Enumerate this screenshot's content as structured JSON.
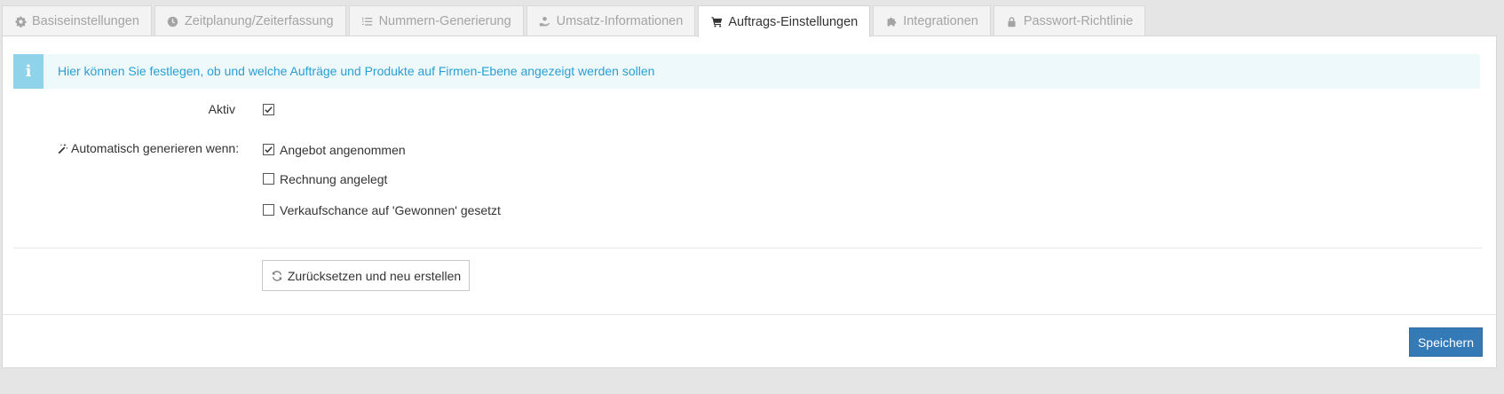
{
  "tabs": [
    {
      "label": "Basiseinstellungen",
      "icon": "gear-icon",
      "active": false
    },
    {
      "label": "Zeitplanung/Zeiterfassung",
      "icon": "clock-icon",
      "active": false
    },
    {
      "label": "Nummern-Generierung",
      "icon": "ordered-list-icon",
      "active": false
    },
    {
      "label": "Umsatz-Informationen",
      "icon": "money-hand-icon",
      "active": false
    },
    {
      "label": "Auftrags-Einstellungen",
      "icon": "shopping-cart-icon",
      "active": true
    },
    {
      "label": "Integrationen",
      "icon": "puzzle-icon",
      "active": false
    },
    {
      "label": "Passwort-Richtlinie",
      "icon": "lock-icon",
      "active": false
    }
  ],
  "info": {
    "icon": "info-icon",
    "text": "Hier können Sie festlegen, ob und welche Aufträge und Produkte auf Firmen-Ebene angezeigt werden sollen"
  },
  "form": {
    "aktiv_label": "Aktiv",
    "aktiv_checked": true,
    "auto_label": "Automatisch generieren wenn:",
    "auto_icon": "magic-wand-icon",
    "options": [
      {
        "label": "Angebot angenommen",
        "checked": true
      },
      {
        "label": "Rechnung angelegt",
        "checked": false
      },
      {
        "label": "Verkaufschance auf 'Gewonnen' gesetzt",
        "checked": false
      }
    ],
    "reset_label": "Zurücksetzen und neu erstellen",
    "reset_icon": "refresh-icon"
  },
  "footer": {
    "save_label": "Speichern"
  },
  "colors": {
    "primary": "#337ab7",
    "info_bg": "#eef9fc",
    "info_accent": "#8fd3eb",
    "info_text": "#2b9ed3"
  }
}
